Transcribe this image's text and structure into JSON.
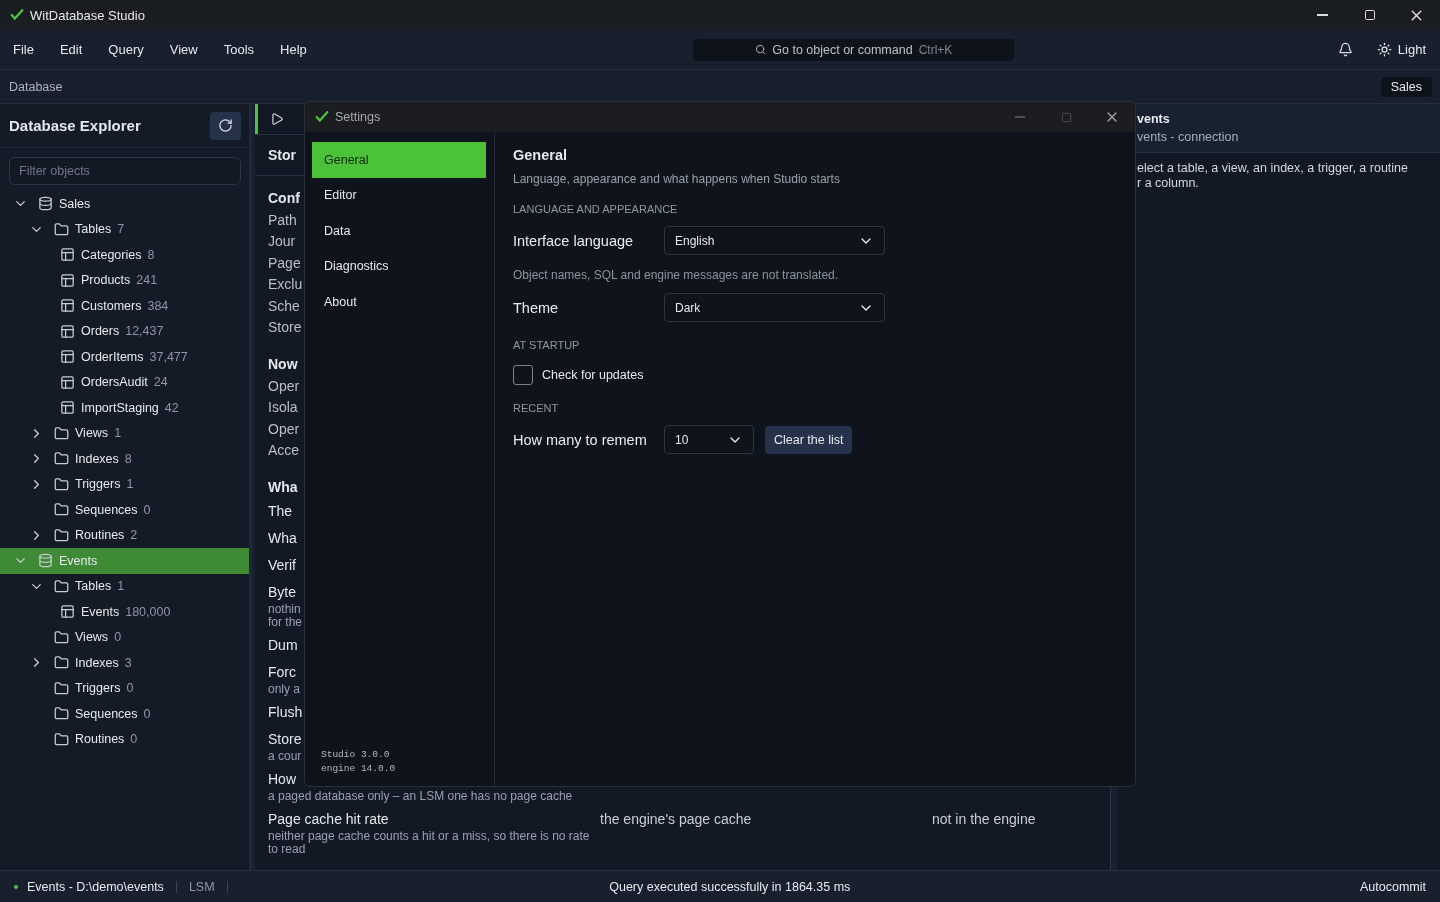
{
  "window": {
    "title": "WitDatabase Studio"
  },
  "menu": [
    {
      "label": "File"
    },
    {
      "label": "Edit"
    },
    {
      "label": "Query"
    },
    {
      "label": "View"
    },
    {
      "label": "Tools"
    },
    {
      "label": "Help"
    }
  ],
  "command_search": {
    "placeholder": "Go to object or command",
    "shortcut": "Ctrl+K"
  },
  "theme_toggle": {
    "label": "Light"
  },
  "breadcrumb": {
    "label": "Database",
    "badge": "Sales"
  },
  "explorer": {
    "title": "Database Explorer",
    "filter": {
      "placeholder": "Filter objects"
    },
    "tree": [
      {
        "label": "Sales",
        "kind": "database",
        "expanded": true,
        "selected": false,
        "children": [
          {
            "label": "Tables",
            "count": "7",
            "kind": "folder",
            "expanded": true,
            "selected": false,
            "children": [
              {
                "label": "Categories",
                "count": "8",
                "kind": "table",
                "selected": false
              },
              {
                "label": "Products",
                "count": "241",
                "kind": "table",
                "selected": false
              },
              {
                "label": "Customers",
                "count": "384",
                "kind": "table",
                "selected": false
              },
              {
                "label": "Orders",
                "count": "12,437",
                "kind": "table",
                "selected": false
              },
              {
                "label": "OrderItems",
                "count": "37,477",
                "kind": "table",
                "selected": false
              },
              {
                "label": "OrdersAudit",
                "count": "24",
                "kind": "table",
                "selected": false
              },
              {
                "label": "ImportStaging",
                "count": "42",
                "kind": "table",
                "selected": false
              }
            ]
          },
          {
            "label": "Views",
            "count": "1",
            "kind": "folder",
            "expanded": false,
            "selected": false
          },
          {
            "label": "Indexes",
            "count": "8",
            "kind": "folder",
            "expanded": false,
            "selected": false
          },
          {
            "label": "Triggers",
            "count": "1",
            "kind": "folder",
            "expanded": false,
            "selected": false
          },
          {
            "label": "Sequences",
            "count": "0",
            "kind": "folder",
            "selected": false
          },
          {
            "label": "Routines",
            "count": "2",
            "kind": "folder",
            "expanded": false,
            "selected": false
          }
        ]
      },
      {
        "label": "Events",
        "kind": "database",
        "expanded": true,
        "selected": true,
        "children": [
          {
            "label": "Tables",
            "count": "1",
            "kind": "folder",
            "expanded": true,
            "selected": false,
            "children": [
              {
                "label": "Events",
                "count": "180,000",
                "kind": "table",
                "selected": false
              }
            ]
          },
          {
            "label": "Views",
            "count": "0",
            "kind": "folder",
            "selected": false
          },
          {
            "label": "Indexes",
            "count": "3",
            "kind": "folder",
            "expanded": false,
            "selected": false
          },
          {
            "label": "Triggers",
            "count": "0",
            "kind": "folder",
            "selected": false
          },
          {
            "label": "Sequences",
            "count": "0",
            "kind": "folder",
            "selected": false
          },
          {
            "label": "Routines",
            "count": "0",
            "kind": "folder",
            "selected": false
          }
        ]
      }
    ]
  },
  "center": {
    "title": "Stor",
    "sections": [
      {
        "heading": "Conf",
        "kind": "list",
        "items": [
          {
            "title": "Path"
          },
          {
            "title": "Jour"
          },
          {
            "title": "Page"
          },
          {
            "title": "Exclu"
          },
          {
            "title": "Sche"
          },
          {
            "title": "Store"
          }
        ]
      },
      {
        "heading": "Now",
        "kind": "list",
        "items": [
          {
            "title": "Oper"
          },
          {
            "title": "Isola"
          },
          {
            "title": "Oper"
          },
          {
            "title": "Acce"
          }
        ]
      },
      {
        "heading": "Wha",
        "kind": "table",
        "items": [
          {
            "title": "The"
          },
          {
            "title": "Wha"
          },
          {
            "title": "Verif"
          },
          {
            "title": "Byte",
            "notes": [
              "nothin",
              "for the"
            ]
          },
          {
            "title": "Dum"
          },
          {
            "title": "Forc",
            "notes": [
              "only a"
            ]
          },
          {
            "title": "Flush"
          },
          {
            "title": "Store",
            "notes": [
              "a cour"
            ]
          },
          {
            "title": "How",
            "notes": [
              "a paged database only – an LSM one has no page cache"
            ]
          },
          {
            "title": "Page cache hit rate",
            "notes": [
              "neither page cache counts a hit or a miss, so there is no rate to read"
            ],
            "column_2": "the engine's page cache",
            "column_3": "not in the engine"
          }
        ]
      }
    ]
  },
  "details": {
    "title": "vents",
    "subtitle": "vents - connection",
    "text": "elect a table, a view, an index, a trigger, a routine r a column."
  },
  "settings": {
    "title": "Settings",
    "nav": [
      {
        "label": "General",
        "selected": true
      },
      {
        "label": "Editor",
        "selected": false
      },
      {
        "label": "Data",
        "selected": false
      },
      {
        "label": "Diagnostics",
        "selected": false
      },
      {
        "label": "About",
        "selected": false
      }
    ],
    "versions": [
      "Studio 3.0.0",
      "engine 14.0.0"
    ],
    "heading": "General",
    "description": "Language, appearance and what happens when Studio starts",
    "groups": [
      {
        "title": "LANGUAGE AND APPEARANCE",
        "rows": [
          {
            "kind": "select",
            "label": "Interface language",
            "value": "English"
          },
          {
            "kind": "hint",
            "text": "Object names, SQL and engine messages are not translated."
          },
          {
            "kind": "select",
            "label": "Theme",
            "value": "Dark"
          }
        ]
      },
      {
        "title": "AT STARTUP",
        "rows": [
          {
            "kind": "checkbox",
            "label": "Check for updates",
            "checked": false
          }
        ]
      },
      {
        "title": "RECENT",
        "rows": [
          {
            "kind": "select_button",
            "label": "How many to remem",
            "value": "10",
            "button": "Clear the list"
          }
        ]
      }
    ]
  },
  "status_bar": {
    "connection": "Events - D:\\demo\\events",
    "engine": "LSM",
    "message": "Query executed successfully in 1864.35 ms",
    "mode": "Autocommit"
  }
}
